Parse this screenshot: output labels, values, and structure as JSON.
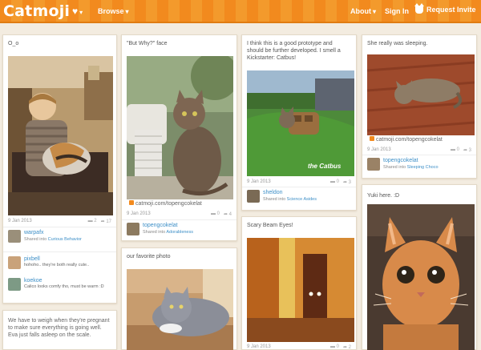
{
  "header": {
    "logo": "Catmoji",
    "browse": "Browse",
    "about": "About",
    "sign_in": "Sign In",
    "request_invite": "Request Invite",
    "accent_color": "#f28a1e"
  },
  "col1": {
    "card1": {
      "title": "O_o",
      "date": "9 Jan 2013",
      "comments": "2",
      "shares": "17",
      "user1": {
        "name": "warpafx",
        "shared_prefix": "Shared into ",
        "shared_board": "Curious Behavior"
      },
      "user2": {
        "name": "pixbell",
        "comment": "hohoho.. they're both really cute.."
      },
      "user3": {
        "name": "koekoe",
        "comment": "Calico looks comfy tho, must be warm :D"
      }
    },
    "card2": {
      "text": "We have to weigh when they're pregnant to make sure everything is going well. Eva just falls asleep on the scale."
    }
  },
  "col2": {
    "card1": {
      "title": "\"But Why?\" face",
      "watermark": "catmoji.com/topengcokelat",
      "date": "9 Jan 2013",
      "comments": "0",
      "shares": "4",
      "user": {
        "name": "topengcokelat",
        "shared_prefix": "Shared into ",
        "shared_board": "Adorableness"
      }
    },
    "card2": {
      "title": "our favorite photo"
    }
  },
  "col3": {
    "card1": {
      "title": "I think this is a good prototype and should be further developed. I smell a Kickstarter: Catbus!",
      "photo_caption": "the Catbus",
      "date": "9 Jan 2013",
      "comments": "0",
      "shares": "3",
      "user": {
        "name": "sheldon",
        "shared_prefix": "Shared into ",
        "shared_board": "Science Asides"
      }
    },
    "card2": {
      "title": "Scary Beam Eyes!",
      "date": "9 Jan 2013",
      "comments": "0",
      "shares": "2"
    }
  },
  "col4": {
    "card1": {
      "title": "She really was sleeping.",
      "watermark": "catmoji.com/topengcokelat",
      "date": "9 Jan 2013",
      "comments": "0",
      "shares": "3",
      "user": {
        "name": "topengcokelat",
        "shared_prefix": "Shared into ",
        "shared_board": "Sleeping Choco"
      }
    },
    "card2": {
      "title": "Yuki here. :D"
    }
  },
  "icons": {
    "comment": "▬",
    "share": "➦"
  }
}
